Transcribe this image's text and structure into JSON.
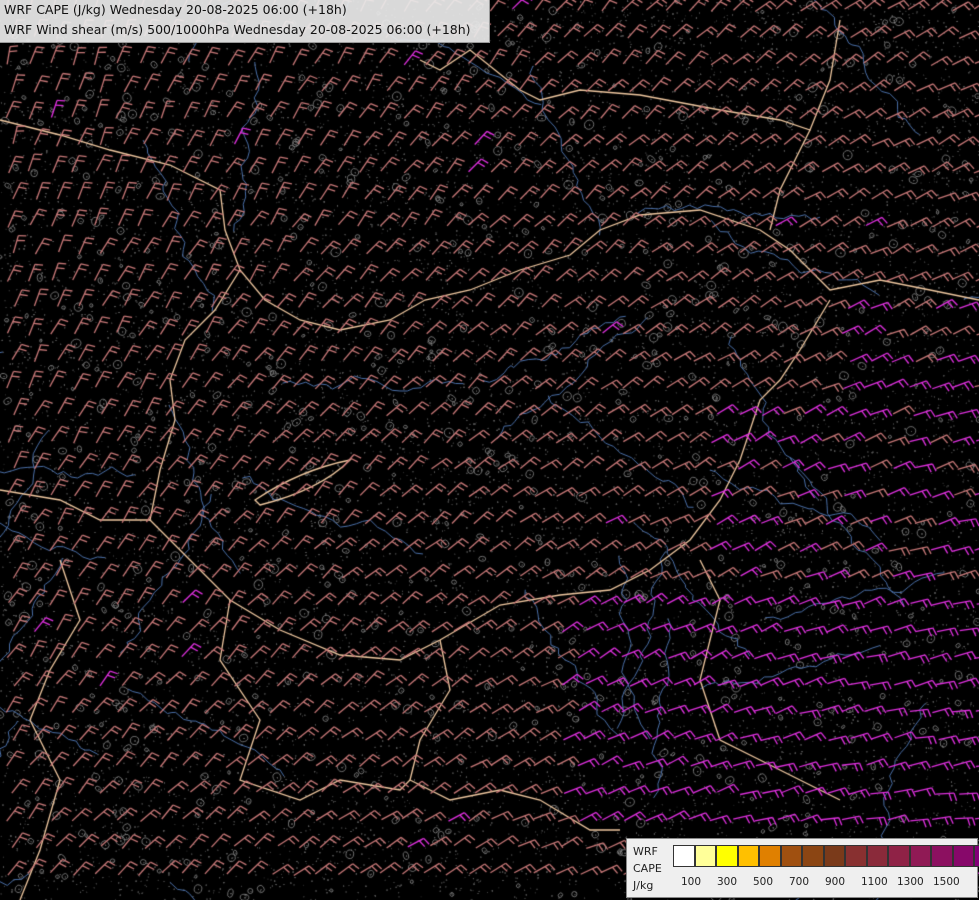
{
  "title": {
    "line1": "WRF CAPE (J/kg) Wednesday 20-08-2025 06:00 (+18h)",
    "line2": "WRF Wind shear (m/s) 500/1000hPa Wednesday 20-08-2025 06:00 (+18h)"
  },
  "legend": {
    "label_line1": "WRF",
    "label_line2": "CAPE",
    "label_line3": "J/kg",
    "swatch_colors": [
      "#ffffff",
      "#ffff99",
      "#ffff00",
      "#ffc000",
      "#e08000",
      "#a05010",
      "#8b4513",
      "#7a3a1a",
      "#883030",
      "#8a2a3a",
      "#8f2246",
      "#901a55",
      "#8c1060",
      "#87086a",
      "#820078"
    ],
    "ticks": [
      "100",
      "300",
      "500",
      "700",
      "900",
      "1100",
      "1300",
      "1500"
    ]
  },
  "colors": {
    "background": "#000000",
    "borders": "#f0c8a0",
    "rivers": "#4a6fa8",
    "barbs_low": "#c87878",
    "barbs_high": "#e030e0"
  }
}
